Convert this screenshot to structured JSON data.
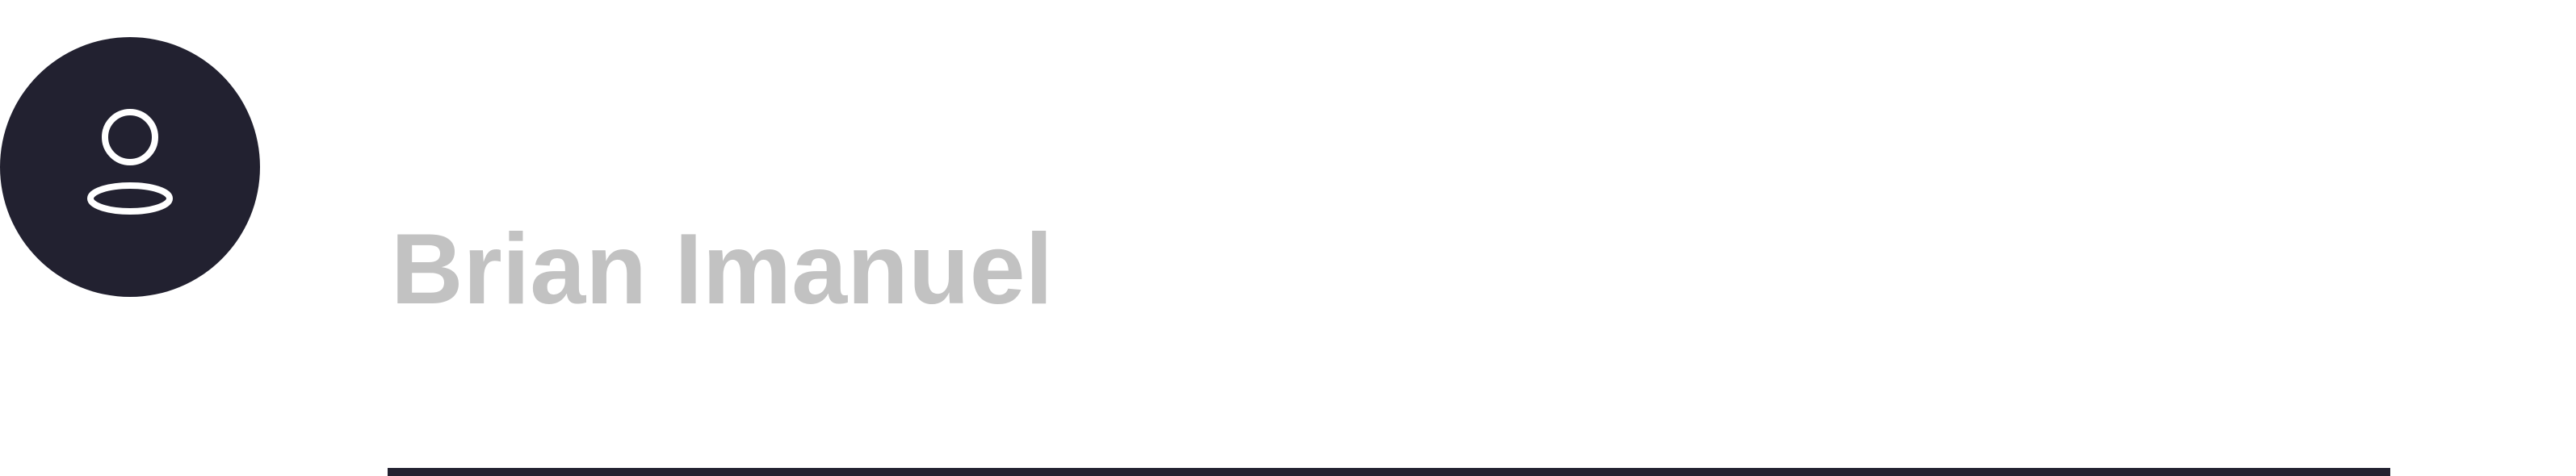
{
  "profile": {
    "name": "Brian Imanuel",
    "avatar_icon": "user-icon"
  },
  "colors": {
    "avatar_background": "#222130",
    "avatar_icon": "#ffffff",
    "name_text": "#c2c2c2",
    "divider": "#222130"
  }
}
